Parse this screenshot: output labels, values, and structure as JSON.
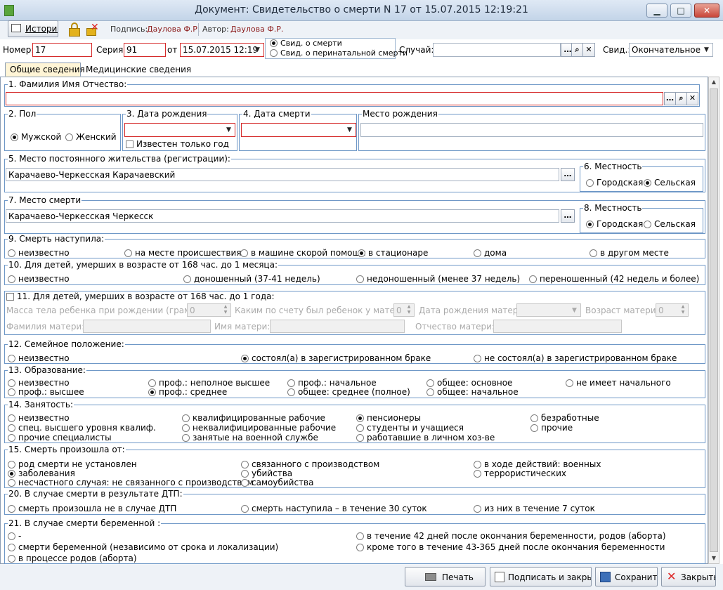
{
  "window": {
    "title": "Документ: Свидетельство о смерти N 17 от 15.07.2015 12:19:21",
    "min": "▁",
    "max": "□",
    "close": "✕"
  },
  "toolbar": {
    "history": "История",
    "lock_icon": "lock-icon",
    "unlock_icon": "unlock-cross-icon",
    "signature_label": "Подпись:",
    "signature_value": "Даулова Ф.Р.",
    "author_label": "Автор:",
    "author_value": "Даулова Ф.Р."
  },
  "header": {
    "number_label": "Номер:",
    "number_value": "17",
    "series_label": "Серия:",
    "series_value": "91",
    "date_label": "от",
    "date_value": "15.07.2015 12:19",
    "cert_type_options": [
      {
        "label": "Свид. о смерти",
        "selected": true
      },
      {
        "label": "Свид. о перинатальной смерти",
        "selected": false
      }
    ],
    "case_label": "Случай:",
    "case_value": "",
    "svid_label": "Свид.:",
    "svid_value": "Окончательное"
  },
  "tabs": [
    {
      "label": "Общие сведения",
      "active": true
    },
    {
      "label": "Медицинские сведения",
      "active": false
    }
  ],
  "form": {
    "fio": {
      "legend": "1. Фамилия Имя Отчество:",
      "value": ""
    },
    "sex": {
      "legend": "2. Пол",
      "options": [
        {
          "label": "Мужской",
          "selected": true
        },
        {
          "label": "Женский",
          "selected": false
        }
      ]
    },
    "birth_date": {
      "legend": "3. Дата рождения",
      "value": "",
      "only_year": "Известен только год"
    },
    "death_date": {
      "legend": "4. Дата смерти",
      "value": ""
    },
    "birth_place": {
      "legend": "Место рождения",
      "value": ""
    },
    "residence": {
      "legend": "5. Место постоянного жительства (регистрации):",
      "value": "Карачаево-Черкесская Карачаевский"
    },
    "residence_locality": {
      "legend": "6. Местность",
      "options": [
        {
          "label": "Городская",
          "selected": false
        },
        {
          "label": "Сельская",
          "selected": true
        }
      ]
    },
    "death_place": {
      "legend": "7. Место смерти",
      "value": "Карачаево-Черкесская Черкесск"
    },
    "death_locality": {
      "legend": "8. Местность",
      "options": [
        {
          "label": "Городская",
          "selected": true
        },
        {
          "label": "Сельская",
          "selected": false
        }
      ]
    },
    "death_occurred": {
      "legend": "9. Смерть наступила:",
      "options": [
        {
          "label": "неизвестно",
          "selected": false
        },
        {
          "label": "на месте происшествия",
          "selected": false
        },
        {
          "label": "в машине скорой помощи",
          "selected": false
        },
        {
          "label": "в стационаре",
          "selected": true
        },
        {
          "label": "дома",
          "selected": false
        },
        {
          "label": "в другом месте",
          "selected": false
        }
      ]
    },
    "children_month": {
      "legend": "10. Для детей,  умерших  в возрасте от 168 час. до 1 месяца:",
      "options": [
        {
          "label": "неизвестно",
          "selected": false
        },
        {
          "label": "доношенный (37-41 недель)",
          "selected": false
        },
        {
          "label": "недоношенный (менее 37 недель)",
          "selected": false
        },
        {
          "label": "переношенный (42 недель и более)",
          "selected": false
        }
      ]
    },
    "children_year": {
      "legend": "11. Для детей, умерших  в  возрасте от 168 час. до 1 года:",
      "mass_label": "Масса тела ребенка при рождении (грамм):",
      "mass_value": "0",
      "order_label": "Каким по счету был ребенок у матери:",
      "order_value": "0",
      "mother_birth_label": "Дата рождения матери:",
      "mother_age_label": "Возраст матери:",
      "mother_age_value": "0",
      "mother_surname_label": "Фамилия матери:",
      "mother_name_label": "Имя матери:",
      "mother_patronymic_label": "Отчество матери:"
    },
    "marital": {
      "legend": "12. Семейное положение:",
      "options": [
        {
          "label": "неизвестно",
          "selected": false
        },
        {
          "label": "состоял(а) в зарегистрированном браке",
          "selected": true
        },
        {
          "label": "не состоял(а) в зарегистрированном браке",
          "selected": false
        }
      ]
    },
    "education": {
      "legend": "13. Образование:",
      "options": [
        {
          "label": "неизвестно",
          "selected": false
        },
        {
          "label": "проф.: неполное высшее",
          "selected": false
        },
        {
          "label": "проф.: начальное",
          "selected": false
        },
        {
          "label": "общее: основное",
          "selected": false
        },
        {
          "label": "не имеет начального",
          "selected": false
        },
        {
          "label": "проф.: высшее",
          "selected": false
        },
        {
          "label": "проф.: среднее",
          "selected": true
        },
        {
          "label": "общее: среднее (полное)",
          "selected": false
        },
        {
          "label": "общее: начальное",
          "selected": false
        }
      ]
    },
    "employment": {
      "legend": "14. Занятость:",
      "options": [
        {
          "label": "неизвестно",
          "selected": false
        },
        {
          "label": "квалифицированные рабочие",
          "selected": false
        },
        {
          "label": "пенсионеры",
          "selected": true
        },
        {
          "label": "безработные",
          "selected": false
        },
        {
          "label": "спец. высшего уровня квалиф.",
          "selected": false
        },
        {
          "label": "неквалифицированные рабочие",
          "selected": false
        },
        {
          "label": "студенты и учащиеся",
          "selected": false
        },
        {
          "label": "прочие",
          "selected": false
        },
        {
          "label": "прочие специалисты",
          "selected": false
        },
        {
          "label": "занятые на военной службе",
          "selected": false
        },
        {
          "label": "работавшие в личном хоз-ве",
          "selected": false
        }
      ]
    },
    "death_from": {
      "legend": "15. Смерть произошла от:",
      "options": [
        {
          "label": "род смерти не установлен",
          "selected": false
        },
        {
          "label": "связанного с производством",
          "selected": false
        },
        {
          "label": "в ходе действий: военных",
          "selected": false
        },
        {
          "label": "заболевания",
          "selected": true
        },
        {
          "label": "убийства",
          "selected": false
        },
        {
          "label": "террористических",
          "selected": false
        },
        {
          "label": "несчастного случая: не связанного с производством",
          "selected": false
        },
        {
          "label": "самоубийства",
          "selected": false
        }
      ]
    },
    "dtp": {
      "legend": "20. В случае смерти в результате ДТП:",
      "options": [
        {
          "label": "смерть произошла не в случае ДТП",
          "selected": false
        },
        {
          "label": "смерть наступила – в течение 30 суток",
          "selected": false
        },
        {
          "label": "из них в течение 7 суток",
          "selected": false
        }
      ]
    },
    "pregnant": {
      "legend": "21. В случае смерти беременной :",
      "options": [
        {
          "label": "-",
          "selected": false
        },
        {
          "label": "в течение  42 дней после окончания беременности, родов (аборта)",
          "selected": false
        },
        {
          "label": "смерти беременной (независимо от срока и локализации)",
          "selected": false
        },
        {
          "label": "кроме того в течение 43-365 дней после окончания беременности",
          "selected": false
        },
        {
          "label": "в процессе родов (аборта)",
          "selected": false
        }
      ]
    }
  },
  "buttons": {
    "print": "Печать",
    "sign_close": "Подписать и закрыть",
    "save": "Сохранить",
    "close": "Закрыть"
  }
}
